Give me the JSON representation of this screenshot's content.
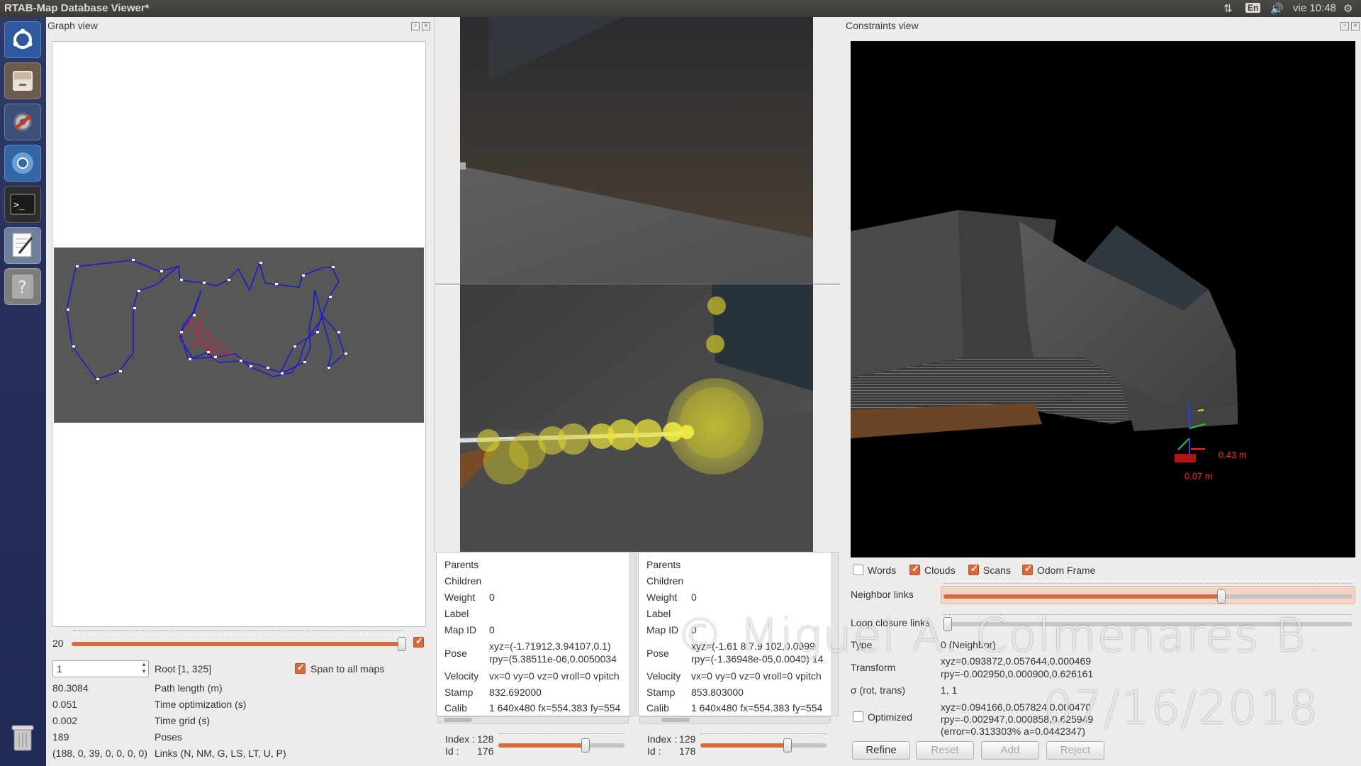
{
  "window": {
    "title": "RTAB-Map Database Viewer*",
    "clock": "vie 10:48",
    "keyboard_layout": "En"
  },
  "launcher": {
    "items": [
      "dash-home",
      "files",
      "system-settings",
      "chromium",
      "terminal",
      "text-editor",
      "help",
      "trash"
    ]
  },
  "graph_view": {
    "title": "Graph view",
    "slider_value": "20",
    "root_input": "1",
    "root_label": "Root [1, 325]",
    "span_label": "Span to all maps",
    "stats": [
      {
        "value": "80.3084",
        "label": "Path length (m)"
      },
      {
        "value": "0.051",
        "label": "Time optimization (s)"
      },
      {
        "value": "0.002",
        "label": "Time grid (s)"
      },
      {
        "value": "189",
        "label": "Poses"
      },
      {
        "value": "(188, 0, 39, 0, 0, 0, 0)",
        "label": "Links (N, NM, G, LS, LT, U, P)"
      }
    ]
  },
  "node_a": {
    "rows": [
      {
        "label": "Parents",
        "value": ""
      },
      {
        "label": "Children",
        "value": ""
      },
      {
        "label": "Weight",
        "value": "0"
      },
      {
        "label": "Label",
        "value": ""
      },
      {
        "label": "Map ID",
        "value": "0"
      },
      {
        "label": "Pose",
        "value": "xyz=(-1.71912,3.94107,0.1)",
        "value2": "rpy=(5.38511e-06,0.0050034"
      },
      {
        "label": "Velocity",
        "value": "vx=0 vy=0 vz=0 vroll=0 vpitch"
      },
      {
        "label": "Stamp",
        "value": "832.692000"
      },
      {
        "label": "Calib",
        "value": "1 640x480 fx=554.383 fy=554"
      }
    ],
    "index_label": "Index :",
    "index": "128",
    "id_label": "Id :",
    "id": "176"
  },
  "node_b": {
    "rows": [
      {
        "label": "Parents",
        "value": ""
      },
      {
        "label": "Children",
        "value": ""
      },
      {
        "label": "Weight",
        "value": "0"
      },
      {
        "label": "Label",
        "value": ""
      },
      {
        "label": "Map ID",
        "value": "0"
      },
      {
        "label": "Pose",
        "value": "xyz=(-1.61 8.7.9 102,0.0999",
        "value2": "rpy=(-1.36948e-05,0.0049) 14"
      },
      {
        "label": "Velocity",
        "value": "vx=0 vy=0 vz=0 vroll=0 vpitch"
      },
      {
        "label": "Stamp",
        "value": "853.803000"
      },
      {
        "label": "Calib",
        "value": "1 640x480 fx=554.383 fy=554"
      }
    ],
    "index_label": "Index :",
    "index": "129",
    "id_label": "Id :",
    "id": "178"
  },
  "constraints_view": {
    "title": "Constraints view",
    "label_1": "0.43 m",
    "label_2": "0.07 m",
    "checkboxes": [
      {
        "label": "Words",
        "checked": false
      },
      {
        "label": "Clouds",
        "checked": true
      },
      {
        "label": "Scans",
        "checked": true
      },
      {
        "label": "Odom Frame",
        "checked": true
      }
    ],
    "neighbor_links_label": "Neighbor links",
    "loop_closure_label": "Loop closure links",
    "type_label": "Type",
    "type_value": "0 (Neighbor)",
    "transform_label": "Transform",
    "transform_line1": "xyz=0.093872,0.057644,0.000469",
    "transform_line2": "rpy=-0.002950,0.000900,0.626161",
    "sigma_label": "σ (rot, trans)",
    "sigma_value": "1, 1",
    "optimized_label": "Optimized",
    "optimized_line1": "xyz=0.094166,0.057824,0.000470",
    "optimized_line2": "rpy=-0.002947,0.000858,0.625949",
    "optimized_line3": "(error=0.313303% a=0.0442347)",
    "buttons": {
      "refine": "Refine",
      "reset": "Reset",
      "add": "Add",
      "reject": "Reject"
    }
  },
  "watermark": {
    "line1": "© Miguel A. Colmenares B.",
    "line2": "07/16/2018"
  },
  "colors": {
    "accent": "#d96a3b",
    "graph_bg": "#575757",
    "graph_path": "#1c1ccf",
    "loop_links": "#d01f3c"
  }
}
